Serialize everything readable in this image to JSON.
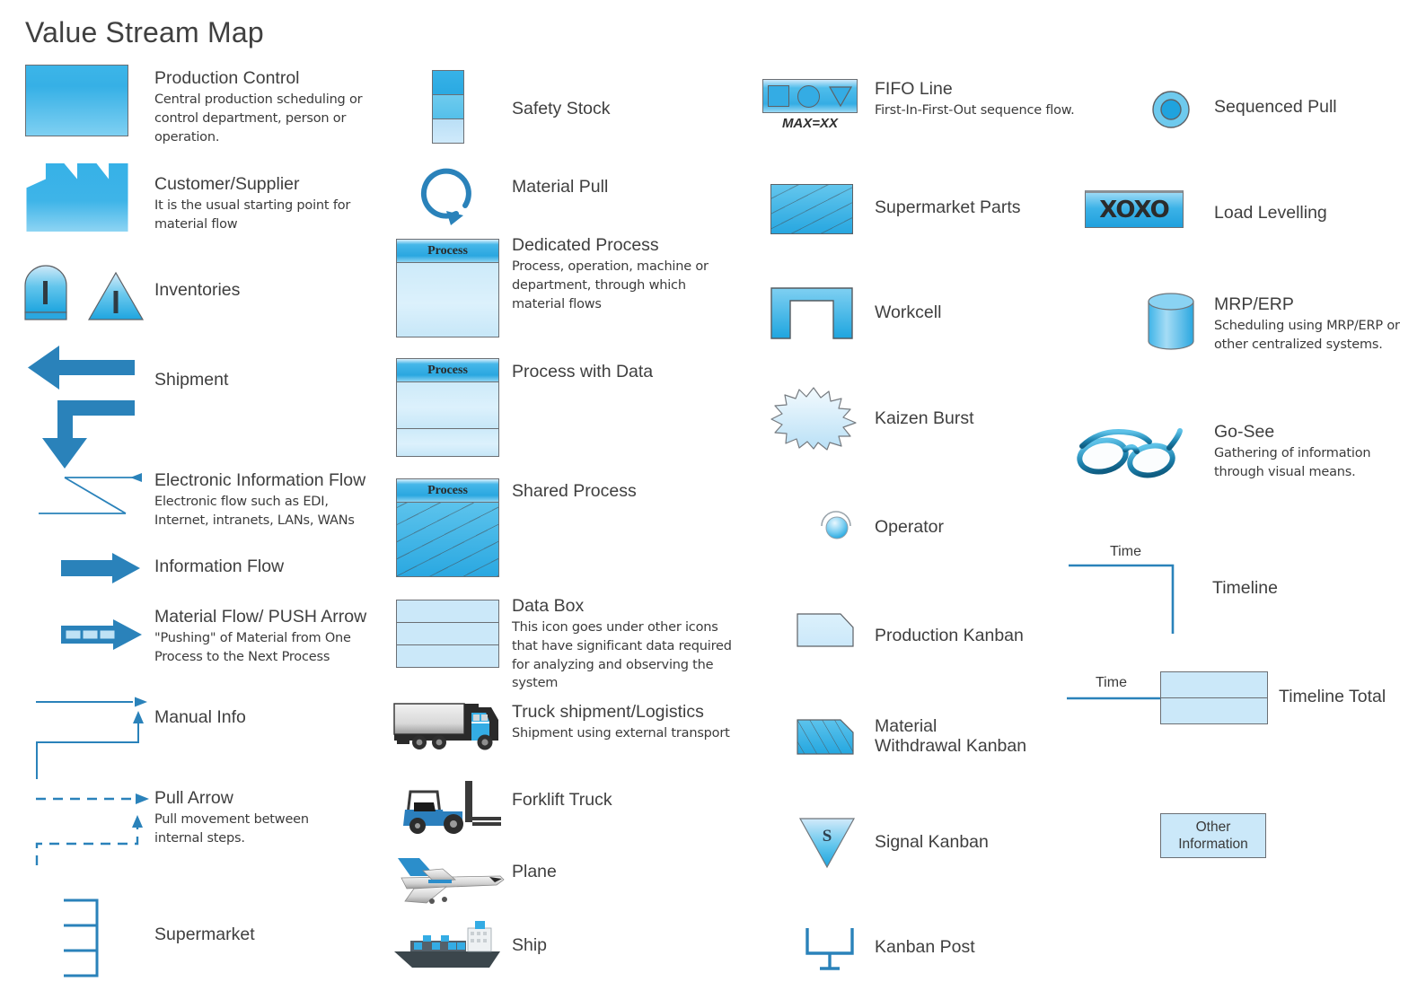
{
  "page": {
    "title": "Value Stream Map"
  },
  "column1": [
    {
      "id": "production-control",
      "title": "Production Control",
      "desc": "Central production scheduling or control department, person or operation.",
      "icon": "production-control-box-icon"
    },
    {
      "id": "customer-supplier",
      "title": "Customer/Supplier",
      "desc": "It is the usual starting point for material flow",
      "icon": "factory-icon"
    },
    {
      "id": "inventories",
      "title": "Inventories",
      "desc": "",
      "icon": "inventory-dome-and-triangle-icon"
    },
    {
      "id": "shipment",
      "title": "Shipment",
      "desc": "",
      "icon": "shipment-arrow-icon"
    },
    {
      "id": "electronic-information-flow",
      "title": "Electronic Information Flow",
      "desc": "Electronic flow such as EDI, Internet, intranets, LANs, WANs",
      "icon": "lightning-flow-arrow-icon"
    },
    {
      "id": "information-flow",
      "title": "Information Flow",
      "desc": "",
      "icon": "solid-block-arrow-icon"
    },
    {
      "id": "material-flow-push-arrow",
      "title": "Material Flow/ PUSH Arrow",
      "desc": "\"Pushing\" of Material from One Process to the Next Process",
      "icon": "striped-push-arrow-icon"
    },
    {
      "id": "manual-info",
      "title": "Manual Info",
      "desc": "",
      "icon": "manual-info-arrow-icon"
    },
    {
      "id": "pull-arrow",
      "title": "Pull Arrow",
      "desc": "Pull movement between internal steps.",
      "icon": "dashed-pull-arrow-icon"
    },
    {
      "id": "supermarket",
      "title": "Supermarket",
      "desc": "",
      "icon": "supermarket-shelves-icon"
    }
  ],
  "column2": [
    {
      "id": "safety-stock",
      "title": "Safety Stock",
      "desc": "",
      "icon": "stacked-boxes-icon"
    },
    {
      "id": "material-pull",
      "title": "Material Pull",
      "desc": "",
      "icon": "circular-arrow-icon"
    },
    {
      "id": "dedicated-process",
      "title": "Dedicated Process",
      "desc": "Process, operation, machine or department, through which material flows",
      "icon": "process-box-icon",
      "box_label": "Process"
    },
    {
      "id": "process-with-data",
      "title": "Process with Data",
      "desc": "",
      "icon": "process-with-data-box-icon",
      "box_label": "Process"
    },
    {
      "id": "shared-process",
      "title": "Shared Process",
      "desc": "",
      "icon": "shared-process-box-icon",
      "box_label": "Process"
    },
    {
      "id": "data-box",
      "title": "Data Box",
      "desc": "This icon goes under other icons that have significant data required for analyzing and observing the system",
      "icon": "data-box-icon"
    },
    {
      "id": "truck-shipment-logistics",
      "title": "Truck shipment/Logistics",
      "desc": "Shipment using external transport",
      "icon": "truck-icon"
    },
    {
      "id": "forklift-truck",
      "title": "Forklift Truck",
      "desc": "",
      "icon": "forklift-icon"
    },
    {
      "id": "plane",
      "title": "Plane",
      "desc": "",
      "icon": "airplane-icon"
    },
    {
      "id": "ship",
      "title": "Ship",
      "desc": "",
      "icon": "cargo-ship-icon"
    }
  ],
  "column3": [
    {
      "id": "fifo-line",
      "title": "FIFO Line",
      "desc": "First-In-First-Out sequence flow.",
      "icon": "fifo-line-icon",
      "caption": "MAX=XX"
    },
    {
      "id": "supermarket-parts",
      "title": "Supermarket Parts",
      "desc": "",
      "icon": "hatched-rectangle-icon"
    },
    {
      "id": "workcell",
      "title": "Workcell",
      "desc": "",
      "icon": "workcell-u-shape-icon"
    },
    {
      "id": "kaizen-burst",
      "title": "Kaizen Burst",
      "desc": "",
      "icon": "starburst-icon"
    },
    {
      "id": "operator",
      "title": "Operator",
      "desc": "",
      "icon": "operator-head-icon"
    },
    {
      "id": "production-kanban",
      "title": "Production Kanban",
      "desc": "",
      "icon": "kanban-card-icon"
    },
    {
      "id": "material-withdrawal-kanban",
      "title": "Material\nWithdrawal Kanban",
      "desc": "",
      "icon": "hatched-kanban-card-icon"
    },
    {
      "id": "signal-kanban",
      "title": "Signal Kanban",
      "desc": "",
      "icon": "signal-triangle-icon",
      "glyph": "S"
    },
    {
      "id": "kanban-post",
      "title": "Kanban Post",
      "desc": "",
      "icon": "kanban-post-icon"
    }
  ],
  "column4": [
    {
      "id": "sequenced-pull",
      "title": "Sequenced Pull",
      "desc": "",
      "icon": "concentric-circle-icon"
    },
    {
      "id": "load-levelling",
      "title": "Load Levelling",
      "desc": "",
      "icon": "load-levelling-icon",
      "glyph": "XOXO"
    },
    {
      "id": "mrp-erp",
      "title": "MRP/ERP",
      "desc": "Scheduling using MRP/ERP or other centralized systems.",
      "icon": "cylinder-database-icon"
    },
    {
      "id": "go-see",
      "title": "Go-See",
      "desc": "Gathering of information through visual means.",
      "icon": "eyeglasses-icon"
    },
    {
      "id": "timeline",
      "title": "Timeline",
      "desc": "",
      "icon": "timeline-step-icon",
      "caption": "Time"
    },
    {
      "id": "timeline-total",
      "title": "Timeline Total",
      "desc": "",
      "icon": "timeline-total-icon",
      "caption": "Time"
    },
    {
      "id": "other-information",
      "title": "",
      "desc": "",
      "icon": "other-information-box-icon",
      "line1": "Other",
      "line2": "Information"
    }
  ],
  "colors": {
    "accent_blue": "#2a8fc4",
    "icon_blue": "#2aa7e0",
    "light_blue_fill": "#cbe8f9",
    "outline_gray": "#6b6f74",
    "text_gray": "#3f3f3f"
  }
}
